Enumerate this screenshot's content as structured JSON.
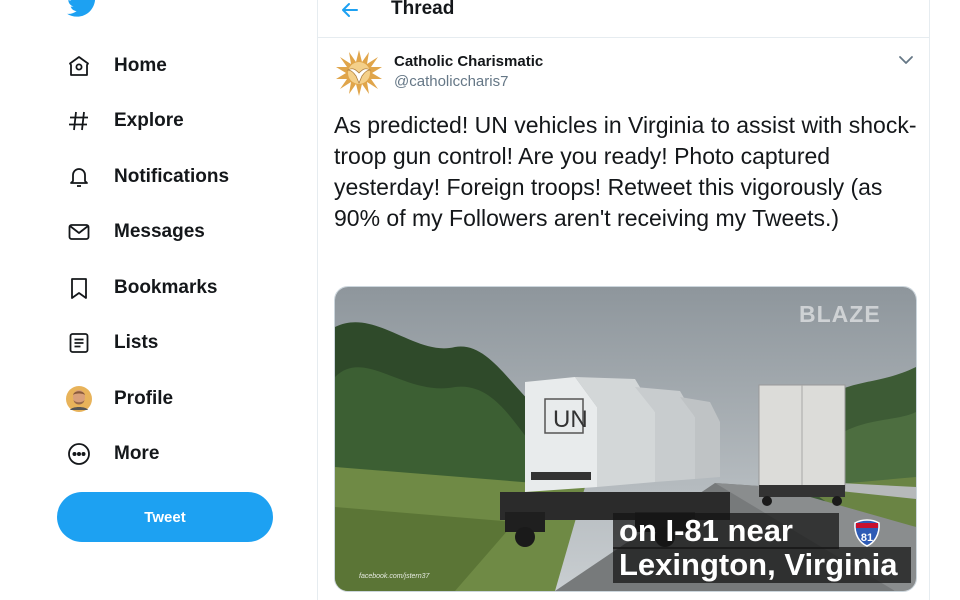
{
  "sidebar": {
    "items": [
      {
        "label": "Home",
        "icon": "home-icon"
      },
      {
        "label": "Explore",
        "icon": "hashtag-icon"
      },
      {
        "label": "Notifications",
        "icon": "bell-icon"
      },
      {
        "label": "Messages",
        "icon": "envelope-icon"
      },
      {
        "label": "Bookmarks",
        "icon": "bookmark-icon"
      },
      {
        "label": "Lists",
        "icon": "list-icon"
      },
      {
        "label": "Profile",
        "icon": "avatar-icon"
      },
      {
        "label": "More",
        "icon": "more-icon"
      }
    ],
    "tweet_button": "Tweet"
  },
  "header": {
    "title": "Thread"
  },
  "tweet": {
    "author_name": "Catholic Charismatic",
    "author_handle": "@catholiccharis7",
    "text": "As predicted! UN vehicles in Virginia to assist with shock-troop gun control!  Are you ready!  Photo captured yesterday! Foreign troops! Retweet this vigorously (as 90% of my Followers aren't receiving my Tweets.)",
    "media": {
      "watermark": "BLAZE",
      "vehicle_marking": "UN",
      "caption_line1": "on I-81 near",
      "caption_line2": "Lexington, Virginia",
      "route_shield": "81",
      "credit": "facebook.com/jstern37"
    }
  },
  "colors": {
    "accent": "#1da1f2",
    "text": "#14171a",
    "muted": "#657786",
    "border": "#e6ecf0"
  }
}
